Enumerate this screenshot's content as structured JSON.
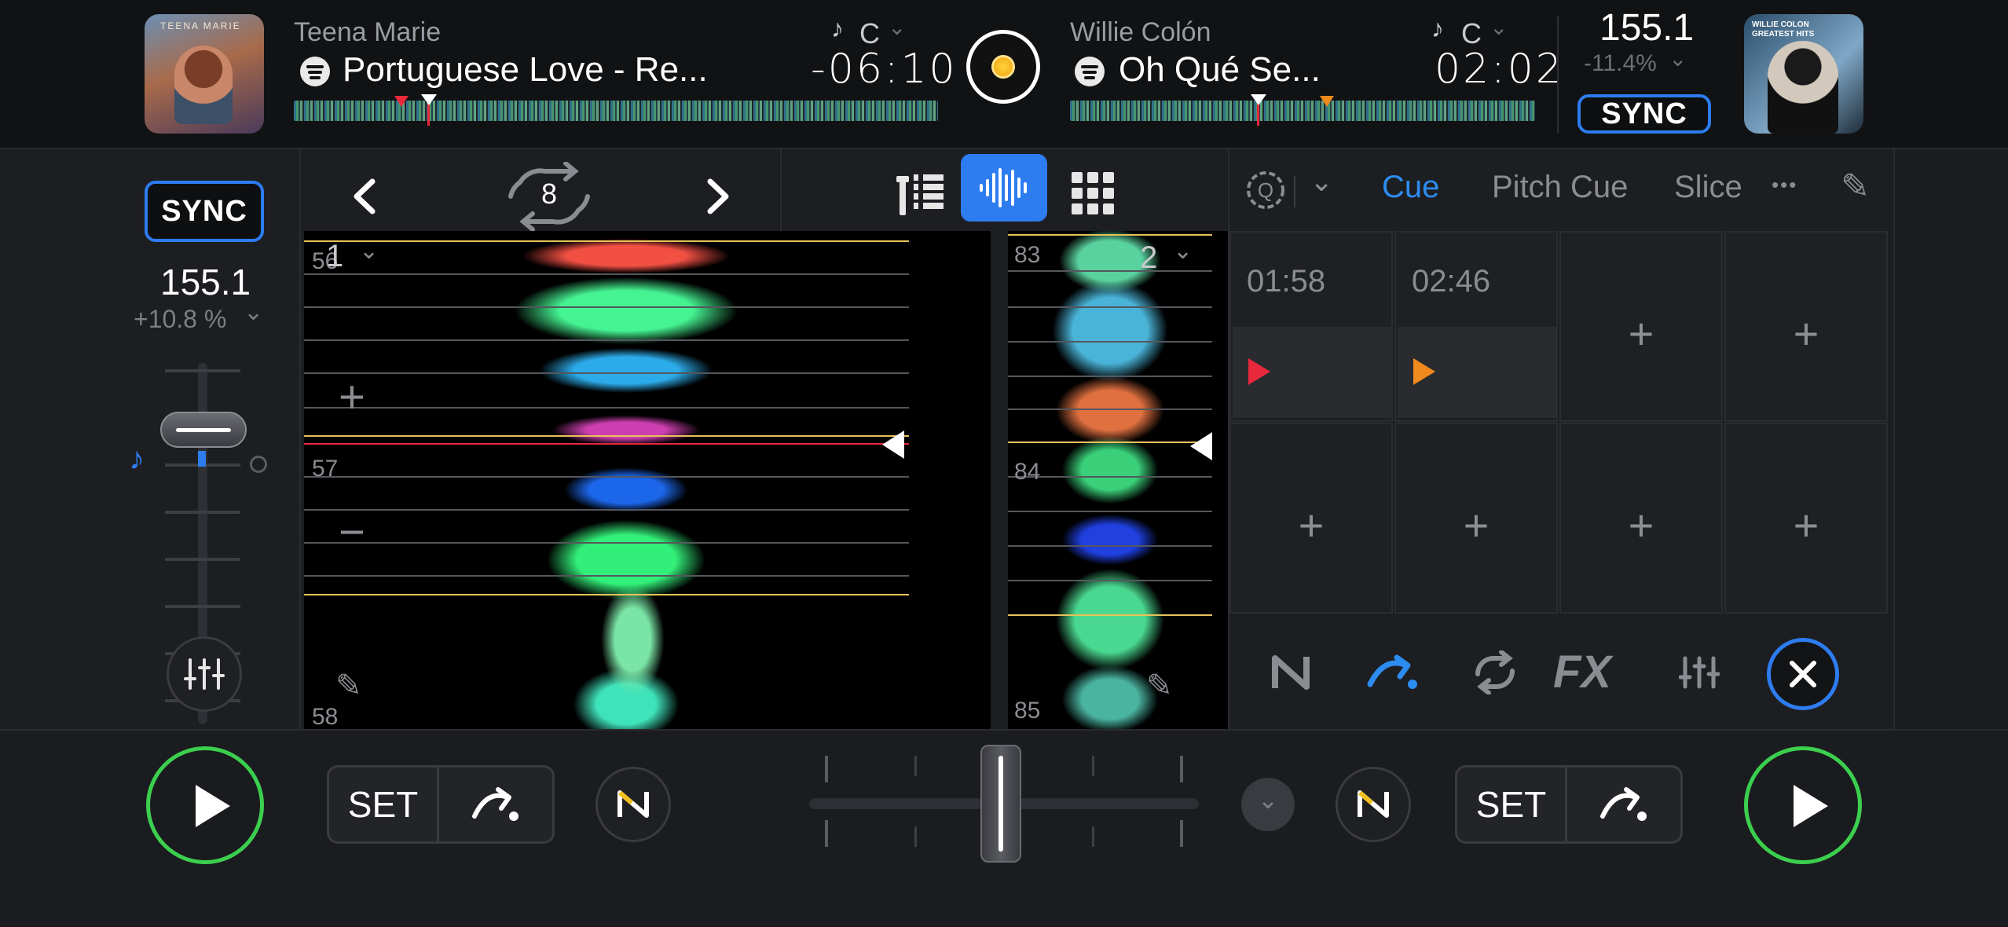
{
  "deck_a": {
    "artist": "Teena Marie",
    "title": "Portuguese Love - Re...",
    "key_label": "C",
    "time": "-06:10",
    "art_text": "TEENA MARIE"
  },
  "deck_b": {
    "artist": "Willie Colón",
    "title": "Oh Qué Se...",
    "key_label": "C",
    "time": "02:02",
    "art_text": "WILLIE COLON GREATEST HITS"
  },
  "master": {
    "bpm": "155.1",
    "pitch": "-11.4%",
    "sync_label": "SYNC"
  },
  "left_panel": {
    "sync_label": "SYNC",
    "bpm": "155.1",
    "pitch": "+10.8 %"
  },
  "wave_toolbar": {
    "loop_size": "8"
  },
  "wave": {
    "deck1_number": "1",
    "deck2_number": "2",
    "deck1_beats": [
      "56",
      "57",
      "58"
    ],
    "deck2_beats": [
      "83",
      "84",
      "85"
    ]
  },
  "right_panel": {
    "tabs": [
      "Cue",
      "Pitch Cue",
      "Slice"
    ],
    "active_tab": "Cue",
    "more_label": "•••",
    "fx_label": "FX",
    "cues": [
      {
        "time": "01:58",
        "color": "#e8283b"
      },
      {
        "time": "02:46",
        "color": "#f08a1c"
      }
    ],
    "empty_pad_label": "+"
  },
  "transport": {
    "set_label": "SET"
  },
  "colors": {
    "accent": "#2d7cf0",
    "play_ring": "#3ccf4e",
    "cue_red": "#e8283b",
    "cue_orange": "#f08a1c",
    "beat_line": "#e8c25a"
  }
}
